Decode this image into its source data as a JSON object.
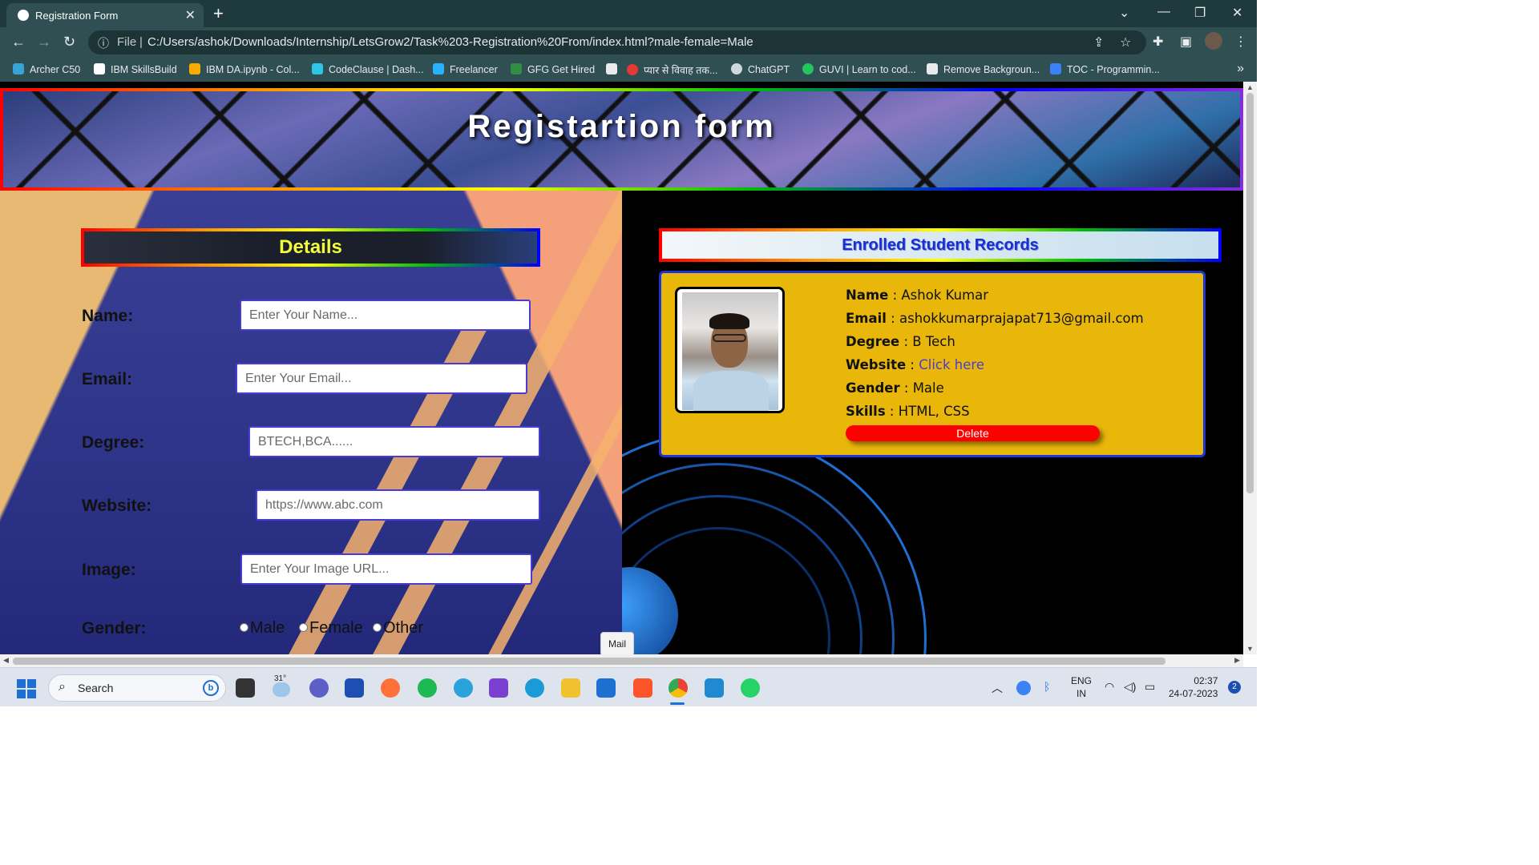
{
  "browser": {
    "tab_title": "Registration Form",
    "new_tab": "+",
    "address_scheme": "File",
    "address_url": "C:/Users/ashok/Downloads/Internship/LetsGrow2/Task%203-Registration%20From/index.html?male-female=Male",
    "bookmarks": [
      {
        "label": "Archer C50",
        "color": "#36a3d9"
      },
      {
        "label": "IBM SkillsBuild",
        "color": "#ffffff"
      },
      {
        "label": "IBM DA.ipynb - Col...",
        "color": "#f9ab00"
      },
      {
        "label": "CodeClause | Dash...",
        "color": "#2ec5e6"
      },
      {
        "label": "Freelancer",
        "color": "#29b2fe"
      },
      {
        "label": "GFG Get Hired",
        "color": "#2f8d46"
      },
      {
        "label": "",
        "color": "#e8eaed"
      },
      {
        "label": "प्यार से विवाह तक...",
        "color": "#e53935"
      },
      {
        "label": "ChatGPT",
        "color": "#cfd8dc"
      },
      {
        "label": "GUVI | Learn to cod...",
        "color": "#22c55e"
      },
      {
        "label": "Remove Backgroun...",
        "color": "#e8eaed"
      },
      {
        "label": "TOC - Programmin...",
        "color": "#3b82f6"
      }
    ],
    "bookmarks_more": "»"
  },
  "page": {
    "header_title": "Registartion form",
    "details_title": "Details",
    "form": {
      "name_label": "Name:",
      "name_placeholder": "Enter Your Name...",
      "email_label": "Email:",
      "email_placeholder": "Enter Your Email...",
      "degree_label": "Degree:",
      "degree_placeholder": "BTECH,BCA......",
      "website_label": "Website:",
      "website_placeholder": "https://www.abc.com",
      "image_label": "Image:",
      "image_placeholder": "Enter Your Image URL...",
      "gender_label": "Gender:",
      "gender_options": [
        "Male",
        "Female",
        "Other"
      ]
    },
    "records": {
      "title": "Enrolled Student Records",
      "student": {
        "name_label": "Name",
        "name": "Ashok Kumar",
        "email_label": "Email",
        "email": "ashokkumarprajapat713@gmail.com",
        "degree_label": "Degree",
        "degree": "B Tech",
        "website_label": "Website",
        "website_link": "Click here",
        "gender_label": "Gender",
        "gender": "Male",
        "skills_label": "Skills",
        "skills": "HTML, CSS",
        "separator": " : "
      },
      "delete_label": "Delete"
    },
    "tooltip": "Mail"
  },
  "taskbar": {
    "search_label": "Search",
    "weather_temp": "31°",
    "lang_line1": "ENG",
    "lang_line2": "IN",
    "time": "02:37",
    "date": "24-07-2023",
    "notification_count": "2"
  },
  "colors": {
    "chrome_bg": "#2f4f52",
    "card_bg": "#e8b70a",
    "accent_blue": "#1b36d6",
    "delete_red": "#ff0000",
    "details_title": "#f2ff3a"
  }
}
